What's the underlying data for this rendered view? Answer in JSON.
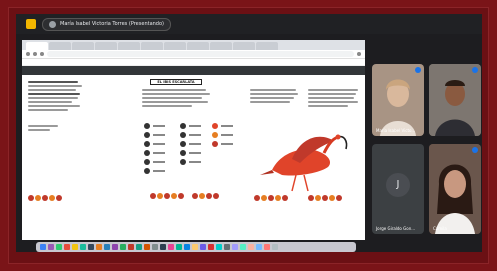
{
  "meeting": {
    "presenter_label": "María Isabel Victoria Torres (Presentando)"
  },
  "browser": {
    "tabs": [
      "",
      "",
      "",
      "",
      "",
      "",
      "",
      "",
      "",
      "",
      ""
    ],
    "url": "",
    "bookmarks": [
      "",
      "",
      "",
      "",
      ""
    ]
  },
  "pdf": {
    "toolbar_left": "",
    "toolbar_right": "",
    "title": "EL IBIS ESCARLATA"
  },
  "participants": [
    {
      "name": "María Isabel Victo...",
      "type": "video",
      "bg": "#a89484"
    },
    {
      "name": "",
      "type": "video",
      "bg": "#6f6a64"
    },
    {
      "name": "Jorge Giraldo Gon...",
      "type": "avatar",
      "initial": "J",
      "bg": "#3c4043"
    },
    {
      "name": "Camila",
      "type": "video",
      "bg": "#5b4a42"
    }
  ],
  "colors": {
    "brand_bg": "#7a1418",
    "accent": "#f2b600",
    "ibis_red": "#e0442a"
  }
}
